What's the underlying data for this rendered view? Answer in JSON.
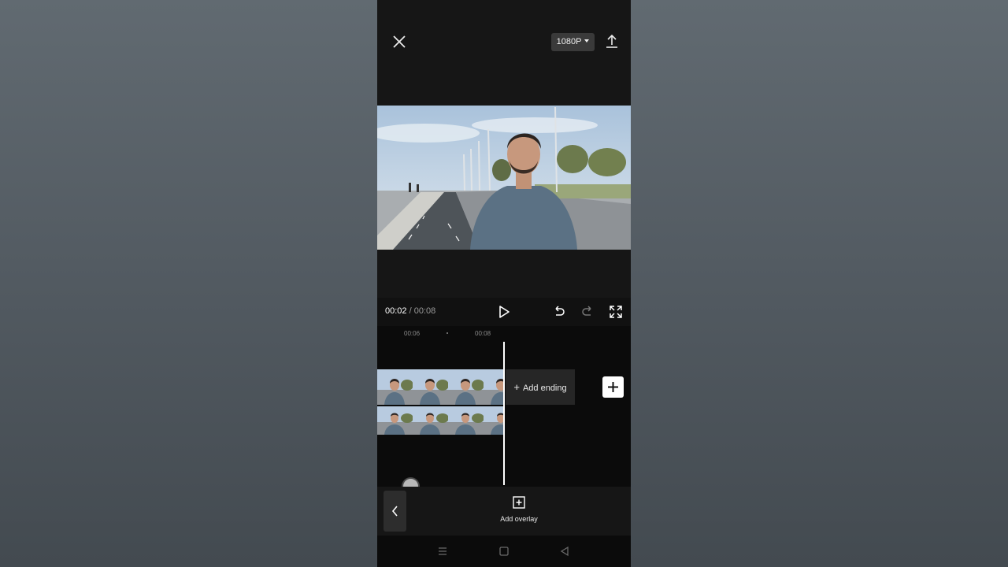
{
  "topbar": {
    "resolution": "1080P"
  },
  "playback": {
    "current_time": "00:02",
    "separator": " / ",
    "total_time": "00:08"
  },
  "timeline": {
    "ruler": [
      "00:06",
      "00:08"
    ],
    "add_ending_label": "Add ending"
  },
  "toolbar": {
    "add_overlay_label": "Add overlay"
  },
  "icons": {
    "close": "close-icon",
    "export": "export-icon",
    "play": "play-icon",
    "undo": "undo-icon",
    "redo": "redo-icon",
    "fullscreen": "fullscreen-icon",
    "add": "plus-icon",
    "back": "chevron-left-icon",
    "overlay": "add-overlay-icon",
    "nav": [
      "menu-icon",
      "home-icon",
      "back-icon"
    ]
  },
  "colors": {
    "accent": "#ffffff",
    "panel": "#161616",
    "background": "#0b0b0b"
  }
}
